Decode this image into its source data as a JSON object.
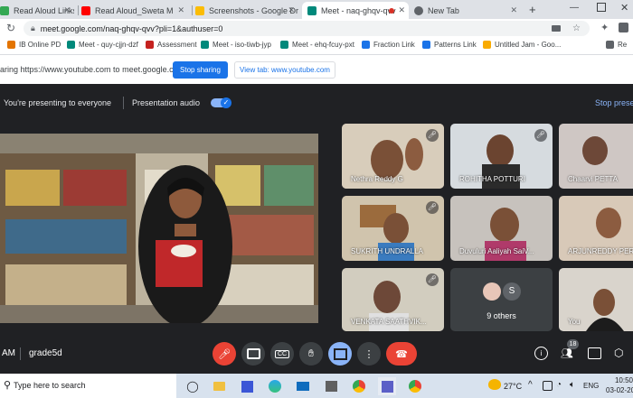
{
  "browser": {
    "tabs": [
      {
        "title": "Read Aloud Links - G",
        "color": "#34a853"
      },
      {
        "title": "Read Aloud_Sweta M",
        "color": "#ff0000"
      },
      {
        "title": "Screenshots - Google Dri",
        "color": "#fbbc04"
      },
      {
        "title": "Meet - naq-ghqv-qvv",
        "color": "#00897b"
      },
      {
        "title": "New Tab",
        "color": "#5f6368"
      }
    ],
    "new_tab_symbol": "+",
    "url": "meet.google.com/naq-ghqv-qvv?pli=1&authuser=0",
    "bookmarks": [
      {
        "label": "IB Online PD",
        "color": "#e37400"
      },
      {
        "label": "Meet - quy-cjjn-dzf",
        "color": "#00897b"
      },
      {
        "label": "Assessment",
        "color": "#c5221f"
      },
      {
        "label": "Meet - iso-tiwb-jyp",
        "color": "#00897b"
      },
      {
        "label": "Meet - ehq-fcuy-pxt",
        "color": "#00897b"
      },
      {
        "label": "Fraction Link",
        "color": "#1a73e8"
      },
      {
        "label": "Patterns Link",
        "color": "#1a73e8"
      },
      {
        "label": "Untitled Jam - Goo...",
        "color": "#f9ab00"
      }
    ],
    "bookmarks_overflow": "Re"
  },
  "share_bar": {
    "message": "aring https://www.youtube.com to meet.google.com",
    "stop_label": "Stop sharing",
    "view_tab_label": "View tab: www.youtube.com"
  },
  "meet": {
    "presenting_text": "You're presenting to everyone",
    "audio_label": "Presentation audio",
    "stop_presenting": "Stop prese",
    "participants": [
      {
        "name": "Nethra Reddy G"
      },
      {
        "name": "ROHITHA POTTURI"
      },
      {
        "name": "Chaarvi PETTA"
      },
      {
        "name": "SUKRITH UNDRALLA"
      },
      {
        "name": "Duvuluri Aaliyah SaiV..."
      },
      {
        "name": "ARJUNREDDY PERI"
      },
      {
        "name": "VENKATA SAATHVIK..."
      },
      {
        "name": "You"
      }
    ],
    "others_label": "9 others",
    "others_initial": "S",
    "time_fragment": "AM",
    "meeting_name": "grade5d",
    "participant_count": "18"
  },
  "taskbar": {
    "search_placeholder": "Type here to search",
    "temperature": "27°C",
    "language": "ENG",
    "time": "10:50",
    "date": "03-02-20"
  }
}
